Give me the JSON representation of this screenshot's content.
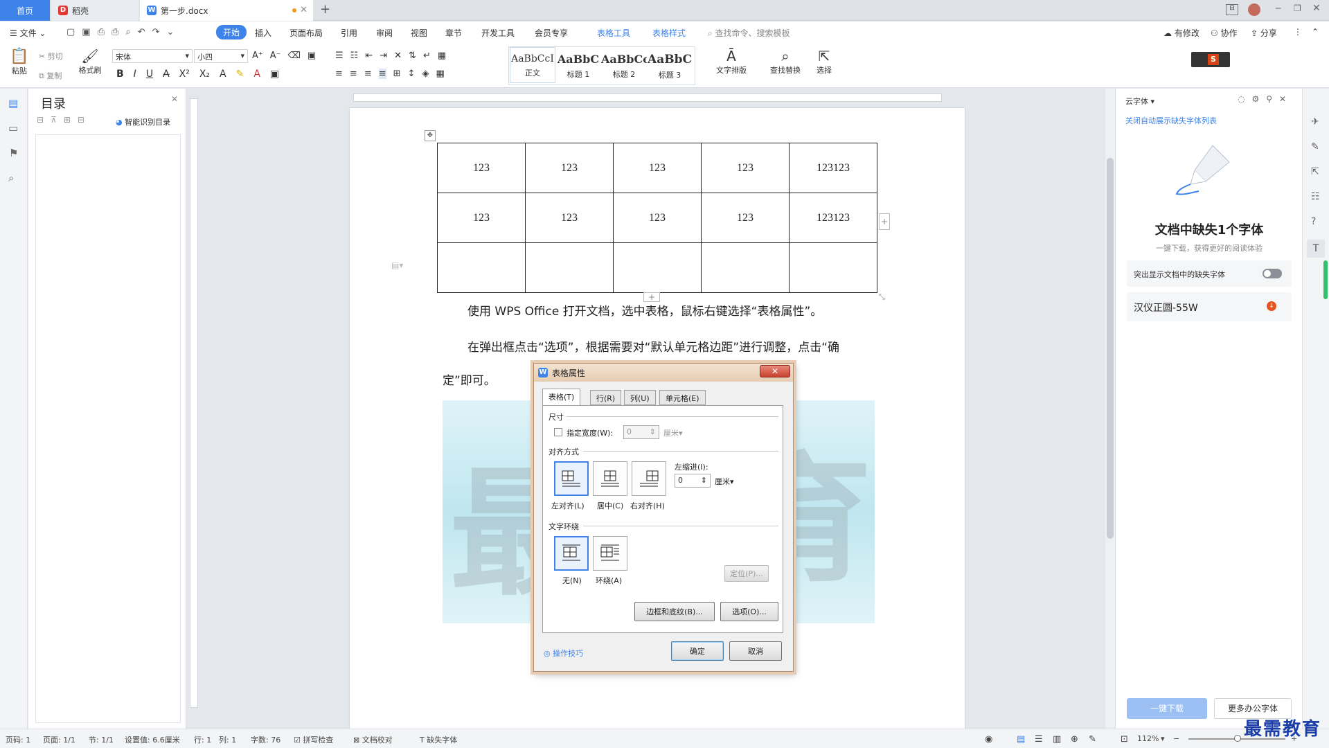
{
  "titlebar": {
    "tabs": [
      {
        "label": "首页"
      },
      {
        "label": "稻壳"
      },
      {
        "label": "第一步.docx"
      }
    ],
    "new_tab": "+"
  },
  "menubar": {
    "file": "文件",
    "items": [
      "开始",
      "插入",
      "页面布局",
      "引用",
      "审阅",
      "视图",
      "章节",
      "开发工具",
      "会员专享"
    ],
    "context": [
      "表格工具",
      "表格样式"
    ],
    "search": "查找命令、搜索模板",
    "right": [
      "有修改",
      "协作",
      "分享"
    ]
  },
  "ribbon": {
    "paste": "粘贴",
    "cut": "剪切",
    "copy": "复制",
    "format_painter": "格式刷",
    "font": "宋体",
    "size": "小四",
    "styles": [
      {
        "sample": "AaBbCcI",
        "name": "正文"
      },
      {
        "sample": "AaBbC",
        "name": "标题 1"
      },
      {
        "sample": "AaBbCc",
        "name": "标题 2"
      },
      {
        "sample": "AaBbC",
        "name": "标题 3"
      }
    ],
    "text_layout": "文字排版",
    "find_replace": "查找替换",
    "select": "选择"
  },
  "toc": {
    "title": "目录",
    "smart": "智能识别目录"
  },
  "document": {
    "table": [
      [
        "123",
        "123",
        "123",
        "123",
        "123123"
      ],
      [
        "123",
        "123",
        "123",
        "123",
        "123123"
      ],
      [
        "",
        "",
        "",
        "",
        ""
      ]
    ],
    "para1": "使用 WPS Office 打开文档，选中表格，鼠标右键选择“表格属性”。",
    "para2a": "在弹出框点击“选项”，根据需要对“默认单元格边距”进行调整，点击“确",
    "para2b": "定”即可。",
    "watermark1": "最",
    "watermark2": "育"
  },
  "dialog": {
    "title": "表格属性",
    "tabs": [
      "表格(T)",
      "行(R)",
      "列(U)",
      "单元格(E)"
    ],
    "size_label": "尺寸",
    "width_label": "指定宽度(W):",
    "width_value": "0",
    "width_unit": "厘米",
    "align_label": "对齐方式",
    "align": [
      "左对齐(L)",
      "居中(C)",
      "右对齐(H)"
    ],
    "indent_label": "左缩进(I):",
    "indent_value": "0",
    "indent_unit": "厘米",
    "wrap_label": "文字环绕",
    "wrap": [
      "无(N)",
      "环绕(A)"
    ],
    "position_btn": "定位(P)...",
    "borders_btn": "边框和底纹(B)...",
    "options_btn": "选项(O)...",
    "tips": "操作技巧",
    "ok": "确定",
    "cancel": "取消"
  },
  "rpane": {
    "header": "云字体",
    "close_auto": "关闭自动展示缺失字体列表",
    "missing_title": "文档中缺失1个字体",
    "missing_sub": "一键下载，获得更好的阅读体验",
    "toggle_label": "突出显示文档中的缺失字体",
    "font_item": "汉仪正圆-55W",
    "download": "一键下载",
    "more": "更多办公字体"
  },
  "statusbar": {
    "page_num": "页码: 1",
    "pages": "页面: 1/1",
    "section": "节: 1/1",
    "setting": "设置值: 6.6厘米",
    "row": "行: 1",
    "col": "列: 1",
    "words": "字数: 76",
    "spell": "拼写检查",
    "proof": "文档校对",
    "missing_font": "缺失字体",
    "zoom": "112%"
  },
  "watermark_brand": "最需教育",
  "colors": {
    "accent": "#3d83e9",
    "dialog_frame": "#e6cdb4",
    "close": "#c9412f"
  }
}
